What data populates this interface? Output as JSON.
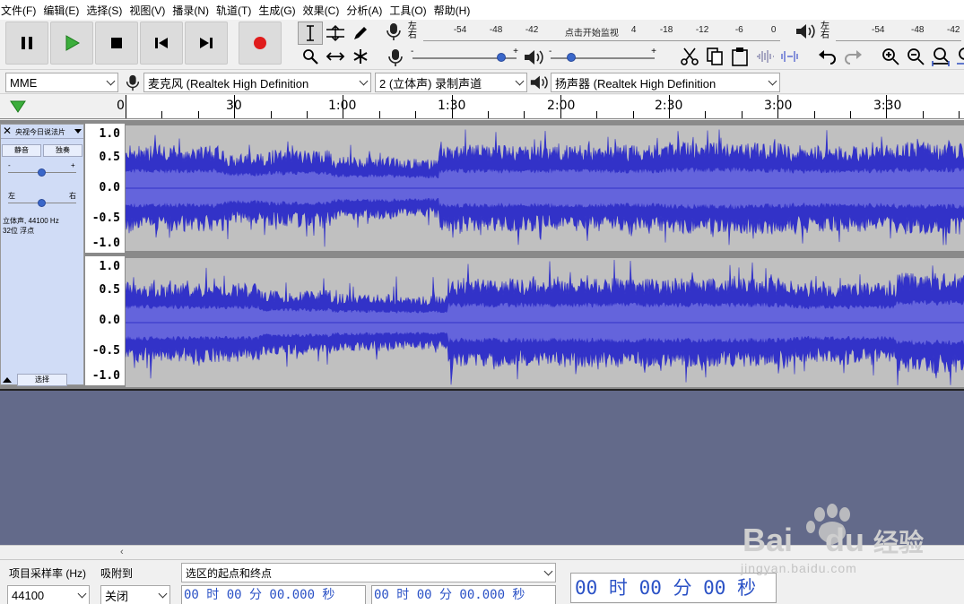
{
  "menu": [
    "文件(F)",
    "编辑(E)",
    "选择(S)",
    "视图(V)",
    "播录(N)",
    "轨道(T)",
    "生成(G)",
    "效果(C)",
    "分析(A)",
    "工具(O)",
    "帮助(H)"
  ],
  "transport": {
    "pause": "pause-icon",
    "play": "play-icon",
    "stop": "stop-icon",
    "skip_start": "skip-start-icon",
    "skip_end": "skip-end-icon",
    "record": "record-icon",
    "play_color": "#3cae3c",
    "record_color": "#e01c1c"
  },
  "meters": {
    "record_lr": [
      "左",
      "右"
    ],
    "record_scale": [
      "-54",
      "-48",
      "-42",
      "点击开始监视",
      "4",
      "-18",
      "-12",
      "-6",
      "0"
    ],
    "play_lr": [
      "左",
      "右"
    ],
    "play_scale": [
      "-54",
      "-48",
      "-42"
    ]
  },
  "sliders": {
    "minus": "-",
    "plus": "+",
    "record_level": 1.0,
    "play_level": 0.15
  },
  "devices": {
    "host": "MME",
    "input": "麦克风 (Realtek High Definition",
    "channels": "2 (立体声) 录制声道",
    "output": "扬声器 (Realtek High Definition"
  },
  "timeline": {
    "zero": "0",
    "labels": [
      "30",
      "1:00",
      "1:30",
      "2:00",
      "2:30",
      "3:00",
      "3:30"
    ]
  },
  "track": {
    "name": "央视今日说法片",
    "mute": "静音",
    "solo": "独奏",
    "gain_minus": "-",
    "gain_plus": "+",
    "pan_left": "左",
    "pan_right": "右",
    "info_line1": "立体声, 44100 Hz",
    "info_line2": "32位 浮点",
    "select": "选择",
    "gain_level": 0.5,
    "pan_level": 0.5
  },
  "vruler": [
    "1.0",
    "0.5",
    "0.0",
    "-0.5",
    "-1.0"
  ],
  "bottom": {
    "rate_label": "项目采样率 (Hz)",
    "rate_value": "44100",
    "snap_label": "吸附到",
    "snap_value": "关闭",
    "sel_mode": "选区的起点和终点",
    "start_time": "00 时 00 分 00.000 秒",
    "end_time": "00 时 00 分 00.000 秒",
    "big_time": "00 时 00 分 00 秒"
  },
  "watermark": {
    "brand": "Bai",
    "brand2": "du",
    "cn": "经验",
    "url": "jingyan.baidu.com"
  },
  "colors": {
    "wave_outer": "#3232c8",
    "wave_inner": "#6464dc",
    "track_bg": "#c0c0c0",
    "empty": "#636a8a",
    "time_text": "#2b52c6"
  }
}
